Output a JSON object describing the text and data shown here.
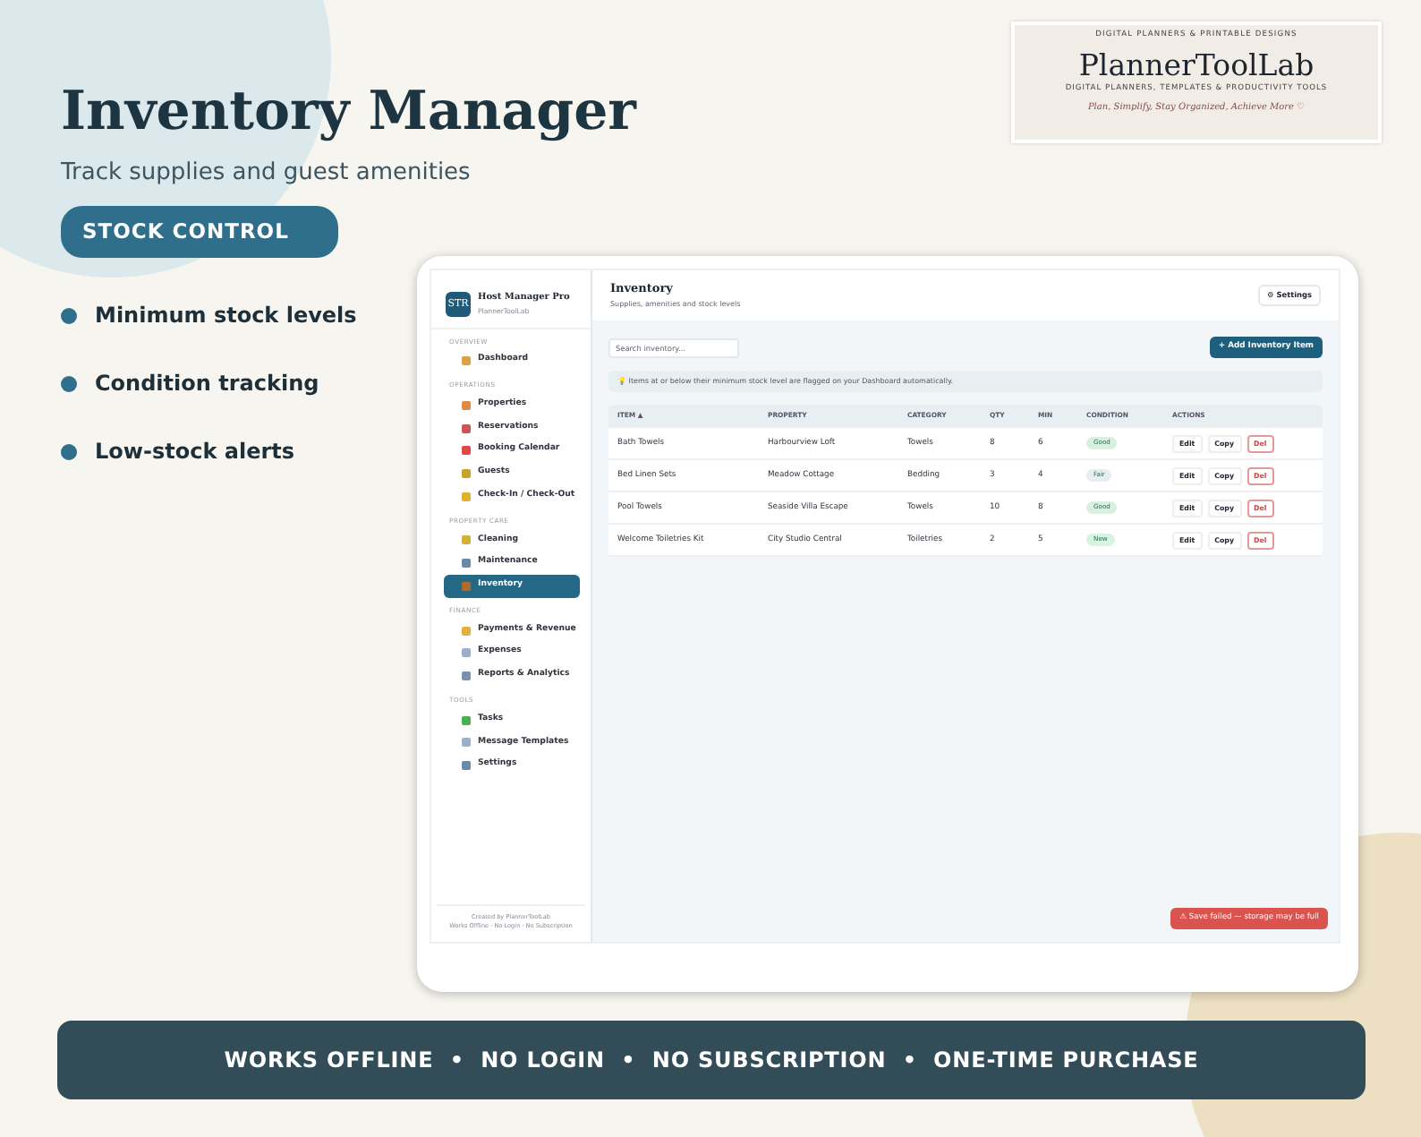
{
  "hero": {
    "title": "Inventory Manager",
    "subtitle": "Track supplies and guest amenities",
    "pill": "STOCK CONTROL"
  },
  "features": [
    "Minimum stock levels",
    "Condition tracking",
    "Low-stock alerts"
  ],
  "logo": {
    "tagline": "DIGITAL PLANNERS & PRINTABLE DESIGNS",
    "name": "PlannerToolLab",
    "subline": "DIGITAL PLANNERS, TEMPLATES & PRODUCTIVITY TOOLS",
    "script": "Plan, Simplify, Stay Organized, Achieve More ♡"
  },
  "app": {
    "brand": {
      "badge": "STR",
      "name": "Host Manager Pro",
      "sub": "PlannerToolLab"
    },
    "sidebar": [
      {
        "section": "OVERVIEW",
        "items": [
          {
            "label": "Dashboard",
            "selected": false
          }
        ]
      },
      {
        "section": "OPERATIONS",
        "items": [
          {
            "label": "Properties",
            "selected": false
          },
          {
            "label": "Reservations",
            "selected": false
          },
          {
            "label": "Booking Calendar",
            "selected": false
          },
          {
            "label": "Guests",
            "selected": false
          },
          {
            "label": "Check-In / Check-Out",
            "selected": false
          }
        ]
      },
      {
        "section": "PROPERTY CARE",
        "items": [
          {
            "label": "Cleaning",
            "selected": false
          },
          {
            "label": "Maintenance",
            "selected": false
          },
          {
            "label": "Inventory",
            "selected": true
          }
        ]
      },
      {
        "section": "FINANCE",
        "items": [
          {
            "label": "Payments & Revenue",
            "selected": false
          },
          {
            "label": "Expenses",
            "selected": false
          },
          {
            "label": "Reports & Analytics",
            "selected": false
          }
        ]
      },
      {
        "section": "TOOLS",
        "items": [
          {
            "label": "Tasks",
            "selected": false
          },
          {
            "label": "Message Templates",
            "selected": false
          },
          {
            "label": "Settings",
            "selected": false
          }
        ]
      }
    ],
    "sidebar_footer": [
      "Created by PlannerToolLab",
      "Works Offline · No Login · No Subscription"
    ],
    "title": "Inventory",
    "subtitle": "Supplies, amenities and stock levels",
    "settings_button": "⚙ Settings",
    "search": {
      "placeholder": "Search inventory..."
    },
    "add_button": "+ Add Inventory Item",
    "notice": "💡 Items at or below their minimum stock level are flagged on your Dashboard automatically.",
    "columns": [
      "ITEM ▲",
      "PROPERTY",
      "CATEGORY",
      "QTY",
      "MIN",
      "CONDITION",
      "ACTIONS"
    ],
    "rows": [
      {
        "item": "Bath Towels",
        "property": "Harbourview Loft",
        "category": "Towels",
        "qty": "8",
        "min": "6",
        "condition": {
          "label": "Good",
          "color": "#d8f0e0"
        },
        "actions": [
          "Edit",
          "Copy",
          "Del"
        ]
      },
      {
        "item": "Bed Linen Sets",
        "property": "Meadow Cottage",
        "category": "Bedding",
        "qty": "3",
        "min": "4",
        "condition": {
          "label": "Fair",
          "color": "#e6eef2"
        },
        "actions": [
          "Edit",
          "Copy",
          "Del"
        ]
      },
      {
        "item": "Pool Towels",
        "property": "Seaside Villa Escape",
        "category": "Towels",
        "qty": "10",
        "min": "8",
        "condition": {
          "label": "Good",
          "color": "#d8f0e0"
        },
        "actions": [
          "Edit",
          "Copy",
          "Del"
        ]
      },
      {
        "item": "Welcome Toiletries Kit",
        "property": "City Studio Central",
        "category": "Toiletries",
        "qty": "2",
        "min": "5",
        "condition": {
          "label": "New",
          "color": "#d6f3e4"
        },
        "actions": [
          "Edit",
          "Copy",
          "Del"
        ]
      }
    ],
    "toast": "⚠ Save failed — storage may be full"
  },
  "banner": "WORKS OFFLINE  •  NO LOGIN  •  NO SUBSCRIPTION  •  ONE-TIME PURCHASE"
}
